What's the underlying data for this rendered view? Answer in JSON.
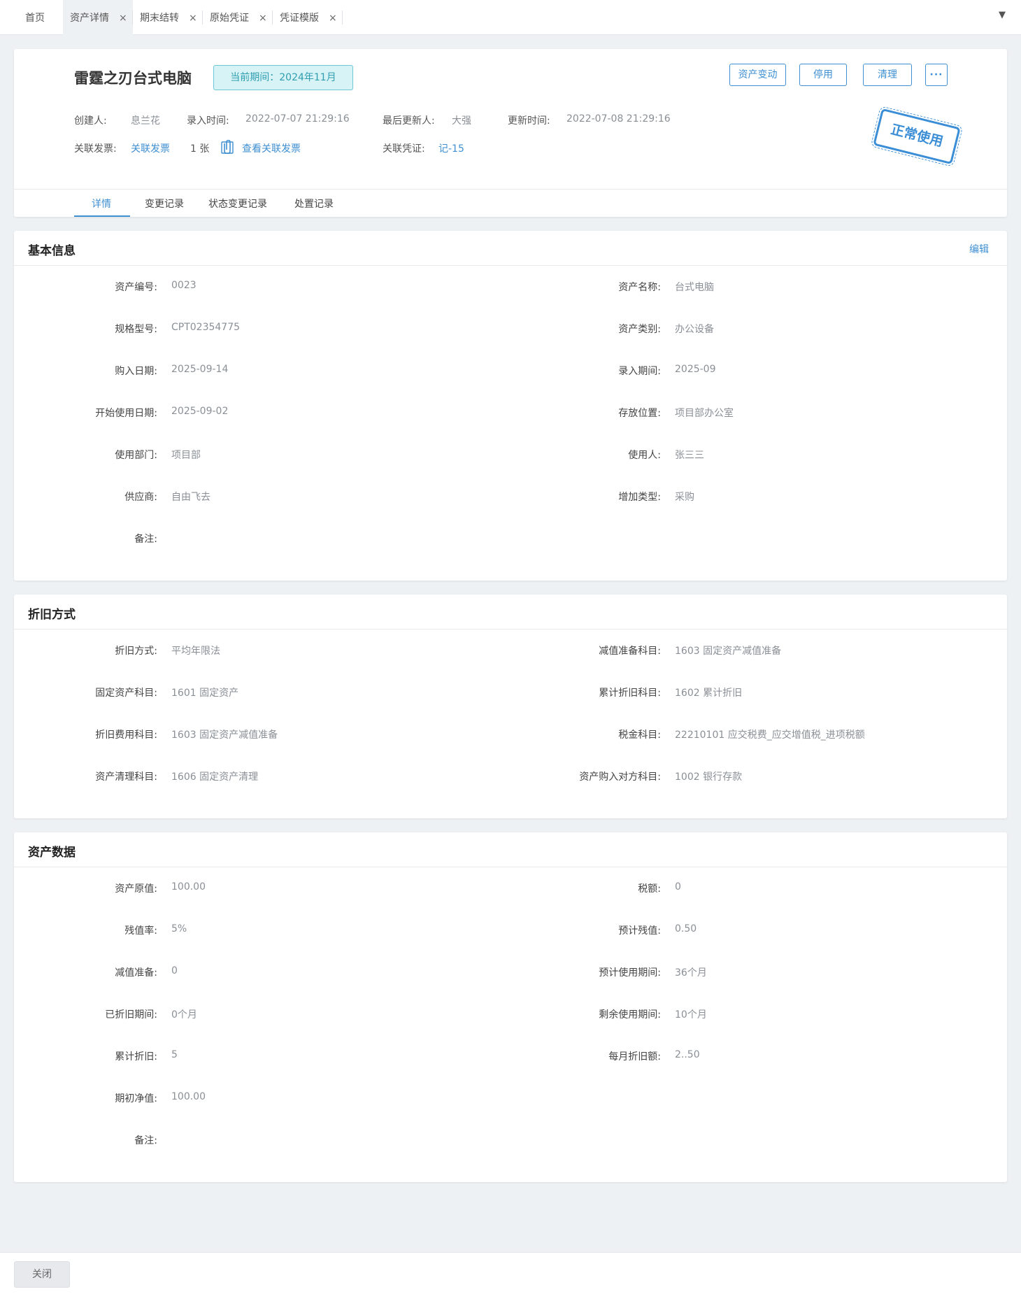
{
  "tabs": {
    "home": "首页",
    "items": [
      {
        "label": "资产详情",
        "active": true
      },
      {
        "label": "期末结转",
        "active": false
      },
      {
        "label": "原始凭证",
        "active": false
      },
      {
        "label": "凭证模版",
        "active": false
      }
    ],
    "close_glyph": "×",
    "dropdown_glyph": "▼"
  },
  "hero": {
    "asset_name": "雷霆之刃台式电脑",
    "period_badge": "当前期间：2024年11月",
    "buttons": {
      "change": "资产变动",
      "disable": "停用",
      "clear": "清理",
      "more": "···"
    },
    "creator_label": "创建人:",
    "creator": "息兰花",
    "entry_time_label": "录入时间:",
    "entry_time": "2022-07-07 21:29:16",
    "last_updater_label": "最后更新人:",
    "last_updater": "大强",
    "update_time_label": "更新时间:",
    "update_time": "2022-07-08 21:29:16",
    "invoice_label": "关联发票:",
    "invoice_link": "关联发票",
    "invoice_count": "1 张",
    "view_invoice": "查看关联发票",
    "voucher_label": "关联凭证:",
    "voucher": "记-15",
    "stamp": "正常使用"
  },
  "subtabs": [
    "详情",
    "变更记录",
    "状态变更记录",
    "处置记录"
  ],
  "basic": {
    "title": "基本信息",
    "edit": "编辑",
    "fields_left": [
      {
        "label": "资产编号:",
        "value": "0023"
      },
      {
        "label": "规格型号:",
        "value": "CPT02354775"
      },
      {
        "label": "购入日期:",
        "value": "2025-09-14"
      },
      {
        "label": "开始使用日期:",
        "value": "2025-09-02"
      },
      {
        "label": "使用部门:",
        "value": "项目部"
      },
      {
        "label": "供应商:",
        "value": "自由飞去"
      },
      {
        "label": "备注:",
        "value": ""
      }
    ],
    "fields_right": [
      {
        "label": "资产名称:",
        "value": "台式电脑"
      },
      {
        "label": "资产类别:",
        "value": "办公设备"
      },
      {
        "label": "录入期间:",
        "value": "2025-09"
      },
      {
        "label": "存放位置:",
        "value": "项目部办公室"
      },
      {
        "label": "使用人:",
        "value": "张三三"
      },
      {
        "label": "增加类型:",
        "value": "采购"
      }
    ]
  },
  "depreciation": {
    "title": "折旧方式",
    "fields_left": [
      {
        "label": "折旧方式:",
        "value": "平均年限法"
      },
      {
        "label": "固定资产科目:",
        "value": "1601 固定资产"
      },
      {
        "label": "折旧费用科目:",
        "value": "1603 固定资产减值准备"
      },
      {
        "label": "资产清理科目:",
        "value": "1606 固定资产清理"
      }
    ],
    "fields_right": [
      {
        "label": "减值准备科目:",
        "value": "1603 固定资产减值准备"
      },
      {
        "label": "累计折旧科目:",
        "value": "1602 累计折旧"
      },
      {
        "label": "税金科目:",
        "value": "22210101 应交税费_应交增值税_进项税额"
      },
      {
        "label": "资产购入对方科目:",
        "value": "1002 银行存款"
      }
    ]
  },
  "asset_data": {
    "title": "资产数据",
    "fields_left": [
      {
        "label": "资产原值:",
        "value": "100.00"
      },
      {
        "label": "残值率:",
        "value": "5%"
      },
      {
        "label": "减值准备:",
        "value": "0"
      },
      {
        "label": "已折旧期间:",
        "value": "0个月"
      },
      {
        "label": "累计折旧:",
        "value": "5"
      },
      {
        "label": "期初净值:",
        "value": "100.00"
      },
      {
        "label": "备注:",
        "value": ""
      }
    ],
    "fields_right": [
      {
        "label": "税额:",
        "value": "0"
      },
      {
        "label": "预计残值:",
        "value": "0.50"
      },
      {
        "label": "预计使用期间:",
        "value": "36个月"
      },
      {
        "label": "剩余使用期间:",
        "value": "10个月"
      },
      {
        "label": "每月折旧额:",
        "value": "2..50"
      }
    ]
  },
  "footer": {
    "close": "关闭"
  }
}
